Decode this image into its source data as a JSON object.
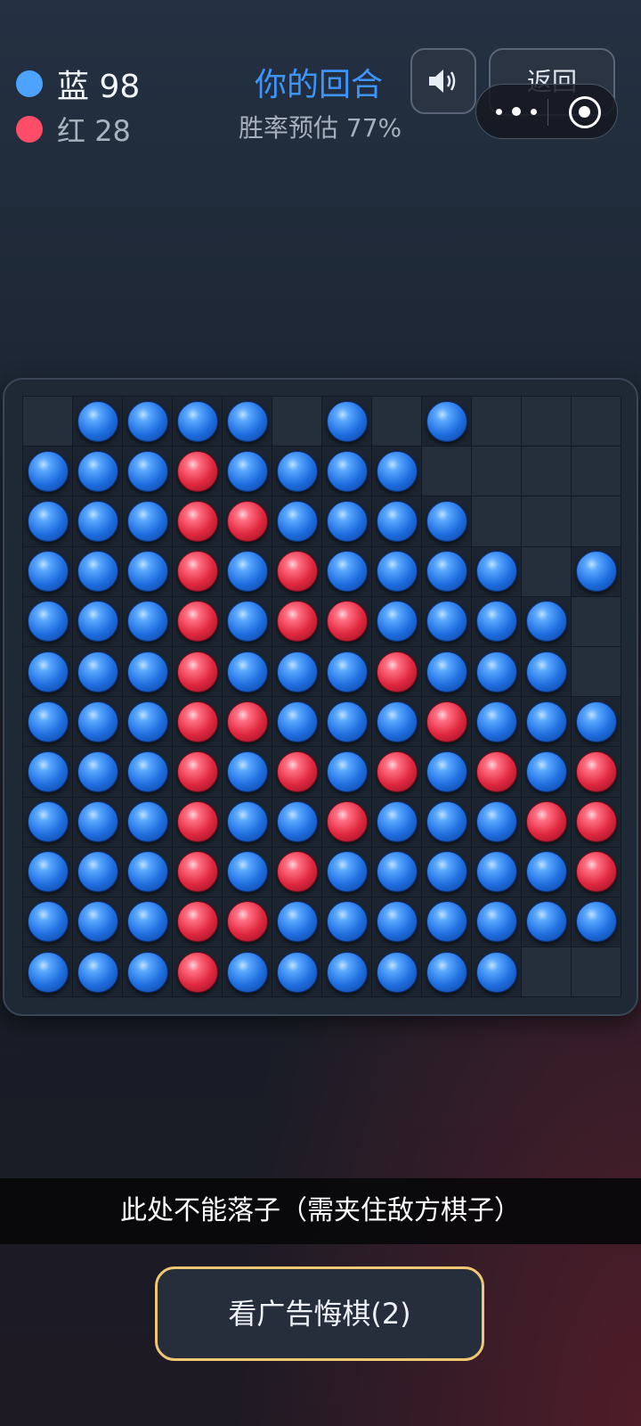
{
  "score": {
    "blue": {
      "label": "蓝",
      "count": "98",
      "color": "#4da3ff"
    },
    "red": {
      "label": "红",
      "count": "28",
      "color": "#ff4d67"
    }
  },
  "status": {
    "turn": "你的回合",
    "winrate": "胜率预估 77%"
  },
  "buttons": {
    "sound_icon": "speaker-icon",
    "back": "返回",
    "undo": "看广告悔棋(2)"
  },
  "capsule": {
    "more_icon": "more-dots-icon",
    "close_icon": "target-icon"
  },
  "toast": "此处不能落子（需夹住敌方棋子）",
  "board": {
    "size": 12,
    "rows": [
      ".BBBB.B.B...",
      "BBBRBBBB....",
      "BBBRRBBBB...",
      "BBBRBRBBBB.B",
      "BBBRBRRBBBB.",
      "BBBRBBBRBBB.",
      "BBBRRBBBRBBB",
      "BBBRBRBRBRBR",
      "BBBRBBRBBBRR",
      "BBBRBRBBBBBR",
      "BBBRRBBBBBBB",
      "BBBRBBBBBB.."
    ]
  }
}
